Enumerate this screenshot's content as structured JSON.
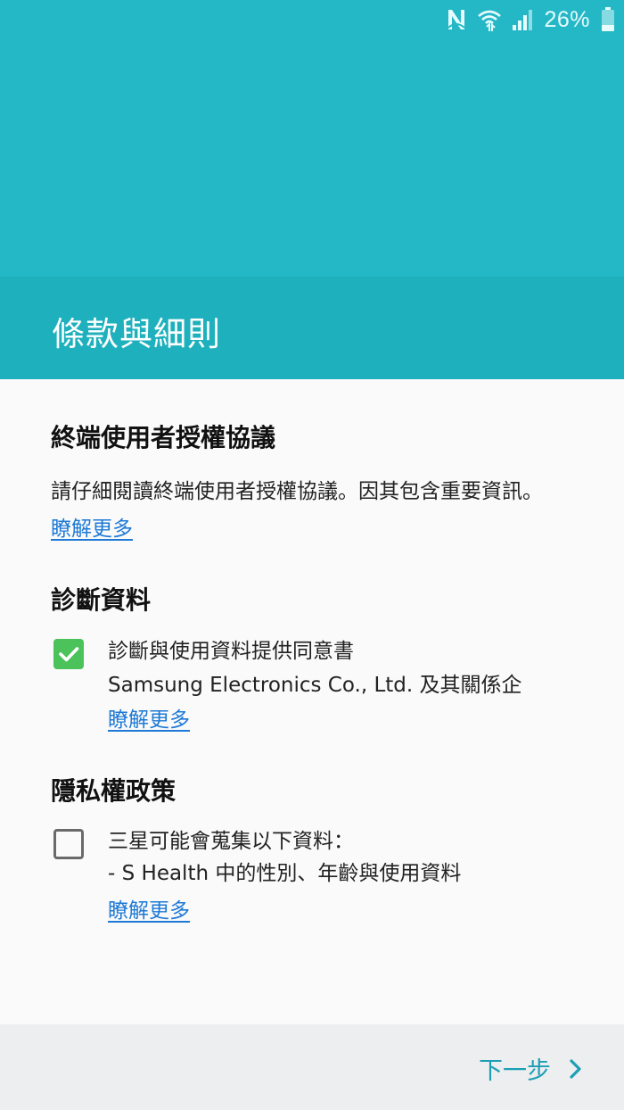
{
  "status_bar": {
    "battery_percent": "26%",
    "icons": [
      "nfc-icon",
      "wifi-icon",
      "signal-icon",
      "battery-icon"
    ]
  },
  "header": {
    "title": "條款與細則"
  },
  "eula": {
    "title": "終端使用者授權協議",
    "description": "請仔細閱讀終端使用者授權協議。因其包含重要資訊。",
    "learn_more": "瞭解更多"
  },
  "diagnostics": {
    "title": "診斷資料",
    "checkbox_checked": true,
    "line1": "診斷與使用資料提供同意書",
    "line2": "Samsung Electronics Co., Ltd. 及其關係企",
    "learn_more": "瞭解更多"
  },
  "privacy": {
    "title": "隱私權政策",
    "checkbox_checked": false,
    "line1": "三星可能會蒐集以下資料：",
    "line2": "- S Health 中的性別、年齡與使用資料",
    "learn_more": "瞭解更多"
  },
  "footer": {
    "next_label": "下一步"
  },
  "colors": {
    "top_band": "#24b8c6",
    "header": "#1eb1bd",
    "link": "#1e7ad6",
    "checkbox_checked": "#4cc25a",
    "next_label": "#1d9fb5"
  }
}
